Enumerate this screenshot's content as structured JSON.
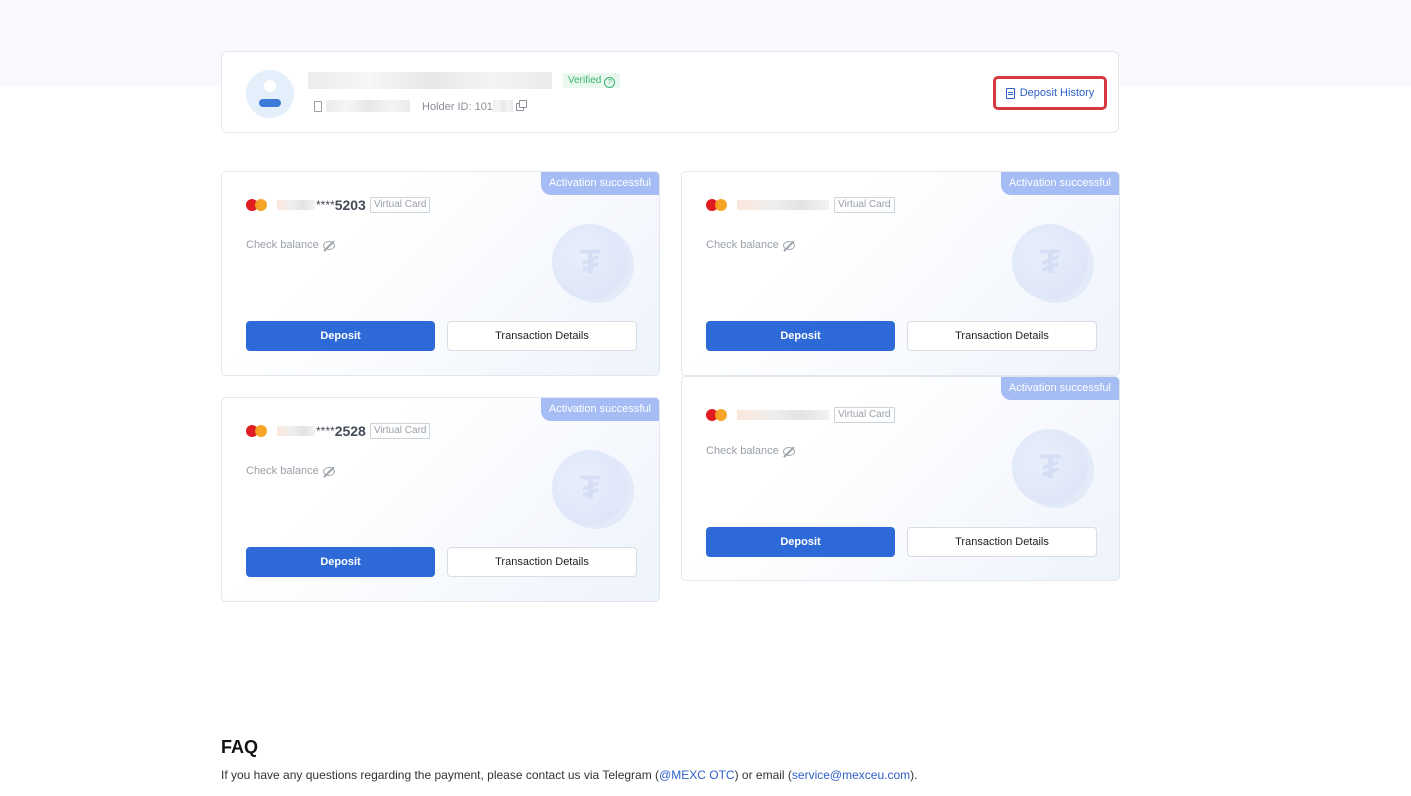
{
  "profile": {
    "verified_label": "Verified",
    "help_icon": "question-circle-icon",
    "holder_label": "Holder ID: 101",
    "deposit_history_label": "Deposit History"
  },
  "cards": [
    {
      "badge": "Activation successful",
      "stars": "****",
      "last4": "5203",
      "type_label": "Virtual Card",
      "check_balance": "Check balance",
      "deposit_label": "Deposit",
      "txn_label": "Transaction Details"
    },
    {
      "badge": "Activation successful",
      "stars": "",
      "last4": "",
      "type_label": "Virtual Card",
      "check_balance": "Check balance",
      "deposit_label": "Deposit",
      "txn_label": "Transaction Details"
    },
    {
      "badge": "Activation successful",
      "stars": "****",
      "last4": "2528",
      "type_label": "Virtual Card",
      "check_balance": "Check balance",
      "deposit_label": "Deposit",
      "txn_label": "Transaction Details"
    },
    {
      "badge": "Activation successful",
      "stars": "",
      "last4": "",
      "type_label": "Virtual Card",
      "check_balance": "Check balance",
      "deposit_label": "Deposit",
      "txn_label": "Transaction Details"
    }
  ],
  "faq": {
    "title": "FAQ",
    "text_before": "If you have any questions regarding the payment, please contact us via Telegram (",
    "telegram_link": "@MEXC OTC",
    "text_middle": ") or email (",
    "email_link": "service@mexceu.com",
    "text_after": ")."
  },
  "colors": {
    "primary": "#2e6ad7",
    "badge": "#a5bdf4",
    "verified_green": "#3bb46e",
    "highlight_red": "#d6393d"
  }
}
